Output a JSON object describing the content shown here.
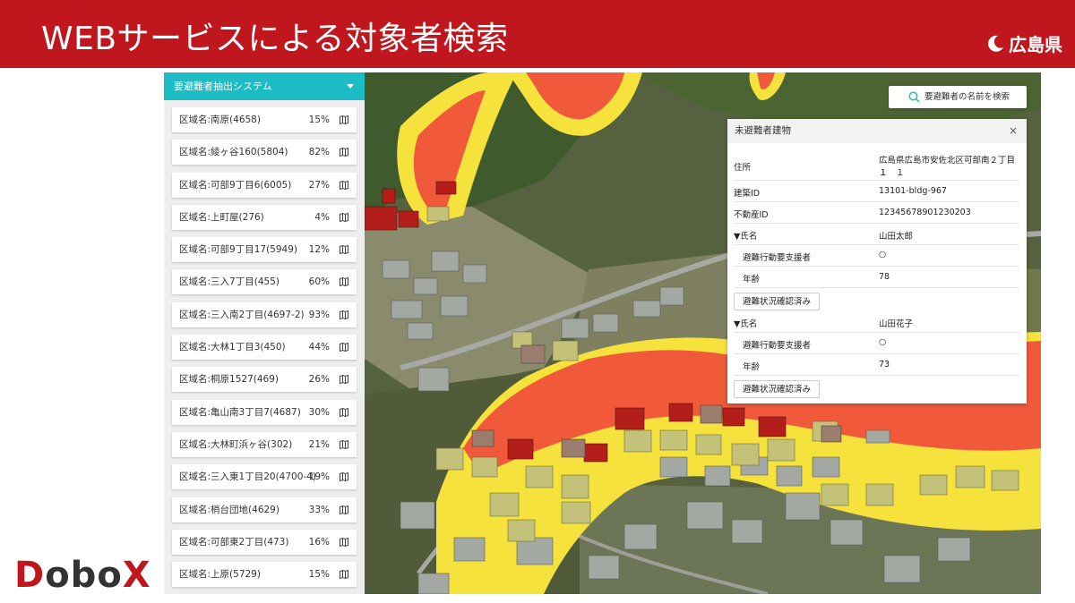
{
  "header": {
    "title": "WEBサービスによる対象者検索",
    "brand_name": "広島県"
  },
  "sidebar": {
    "title": "要避難者抽出システム",
    "items": [
      {
        "name": "区域名:南原(4658)",
        "percent": "15%"
      },
      {
        "name": "区域名:綾ヶ谷160(5804)",
        "percent": "82%"
      },
      {
        "name": "区域名:可部9丁目6(6005)",
        "percent": "27%"
      },
      {
        "name": "区域名:上町屋(276)",
        "percent": "4%"
      },
      {
        "name": "区域名:可部9丁目17(5949)",
        "percent": "12%"
      },
      {
        "name": "区域名:三入7丁目(455)",
        "percent": "60%"
      },
      {
        "name": "区域名:三入南2丁目(4697-2)",
        "percent": "93%"
      },
      {
        "name": "区域名:大林1丁目3(450)",
        "percent": "44%"
      },
      {
        "name": "区域名:桐原1527(469)",
        "percent": "26%"
      },
      {
        "name": "区域名:亀山南3丁目7(4687)",
        "percent": "30%"
      },
      {
        "name": "区域名:大林町浜ヶ谷(302)",
        "percent": "21%"
      },
      {
        "name": "区域名:三入東1丁目20(4700-4)",
        "percent": "19%"
      },
      {
        "name": "区域名:梢台団地(4629)",
        "percent": "33%"
      },
      {
        "name": "区域名:可部東2丁目(473)",
        "percent": "16%"
      },
      {
        "name": "区域名:上原(5729)",
        "percent": "15%"
      }
    ]
  },
  "search": {
    "label": "要避難者の名前を検索"
  },
  "panel": {
    "title": "未避難者建物",
    "close": "×",
    "address_label": "住所",
    "address_line1": "広島県広島市安佐北区可部南２丁目１",
    "address_line2": "１　１",
    "building_id_label": "建築ID",
    "building_id": "13101-bldg-967",
    "property_id_label": "不動産ID",
    "property_id": "12345678901230203",
    "persons": [
      {
        "name_label": "▼氏名",
        "name": "山田太郎",
        "support_label": "避難行動要支援者",
        "support_value": "○",
        "age_label": "年齢",
        "age": "78",
        "button": "避難状況確認済み"
      },
      {
        "name_label": "▼氏名",
        "name": "山田花子",
        "support_label": "避難行動要支援者",
        "support_value": "○",
        "age_label": "年齢",
        "age": "73",
        "button": "避難状況確認済み"
      }
    ]
  },
  "logo": {
    "part1": "D",
    "part2": "obo",
    "part3": "X"
  },
  "colors": {
    "header_bg": "#c0171e",
    "sidebar_header_bg": "#1cbcc4",
    "hazard_red": "#f05a3a",
    "hazard_yellow": "#f6e23c",
    "logo_red": "#c0171e",
    "logo_dark": "#333333"
  }
}
